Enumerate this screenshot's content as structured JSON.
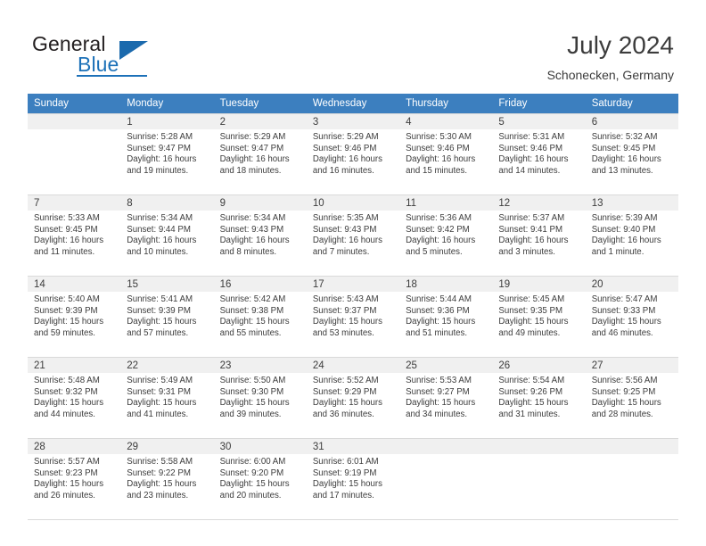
{
  "logo": {
    "word1": "General",
    "word2": "Blue",
    "triangle_color": "#1b6aad",
    "blue_color": "#1d71b8"
  },
  "header": {
    "title": "July 2024",
    "subtitle": "Schonecken, Germany"
  },
  "theme": {
    "header_row_bg": "#3c7fbf",
    "daynum_bg": "#f0f0f0",
    "grid_line": "#d9d9d9",
    "text": "#3c3c3c"
  },
  "calendar": {
    "weekday_headers": [
      "Sunday",
      "Monday",
      "Tuesday",
      "Wednesday",
      "Thursday",
      "Friday",
      "Saturday"
    ],
    "labels": {
      "sunrise": "Sunrise:",
      "sunset": "Sunset:",
      "daylight": "Daylight:"
    },
    "weeks": [
      [
        {
          "day": "",
          "sunrise": "",
          "sunset": "",
          "daylight": "",
          "empty": true
        },
        {
          "day": "1",
          "sunrise": "Sunrise: 5:28 AM",
          "sunset": "Sunset: 9:47 PM",
          "daylight_l1": "Daylight: 16 hours",
          "daylight_l2": "and 19 minutes."
        },
        {
          "day": "2",
          "sunrise": "Sunrise: 5:29 AM",
          "sunset": "Sunset: 9:47 PM",
          "daylight_l1": "Daylight: 16 hours",
          "daylight_l2": "and 18 minutes."
        },
        {
          "day": "3",
          "sunrise": "Sunrise: 5:29 AM",
          "sunset": "Sunset: 9:46 PM",
          "daylight_l1": "Daylight: 16 hours",
          "daylight_l2": "and 16 minutes."
        },
        {
          "day": "4",
          "sunrise": "Sunrise: 5:30 AM",
          "sunset": "Sunset: 9:46 PM",
          "daylight_l1": "Daylight: 16 hours",
          "daylight_l2": "and 15 minutes."
        },
        {
          "day": "5",
          "sunrise": "Sunrise: 5:31 AM",
          "sunset": "Sunset: 9:46 PM",
          "daylight_l1": "Daylight: 16 hours",
          "daylight_l2": "and 14 minutes."
        },
        {
          "day": "6",
          "sunrise": "Sunrise: 5:32 AM",
          "sunset": "Sunset: 9:45 PM",
          "daylight_l1": "Daylight: 16 hours",
          "daylight_l2": "and 13 minutes."
        }
      ],
      [
        {
          "day": "7",
          "sunrise": "Sunrise: 5:33 AM",
          "sunset": "Sunset: 9:45 PM",
          "daylight_l1": "Daylight: 16 hours",
          "daylight_l2": "and 11 minutes."
        },
        {
          "day": "8",
          "sunrise": "Sunrise: 5:34 AM",
          "sunset": "Sunset: 9:44 PM",
          "daylight_l1": "Daylight: 16 hours",
          "daylight_l2": "and 10 minutes."
        },
        {
          "day": "9",
          "sunrise": "Sunrise: 5:34 AM",
          "sunset": "Sunset: 9:43 PM",
          "daylight_l1": "Daylight: 16 hours",
          "daylight_l2": "and 8 minutes."
        },
        {
          "day": "10",
          "sunrise": "Sunrise: 5:35 AM",
          "sunset": "Sunset: 9:43 PM",
          "daylight_l1": "Daylight: 16 hours",
          "daylight_l2": "and 7 minutes."
        },
        {
          "day": "11",
          "sunrise": "Sunrise: 5:36 AM",
          "sunset": "Sunset: 9:42 PM",
          "daylight_l1": "Daylight: 16 hours",
          "daylight_l2": "and 5 minutes."
        },
        {
          "day": "12",
          "sunrise": "Sunrise: 5:37 AM",
          "sunset": "Sunset: 9:41 PM",
          "daylight_l1": "Daylight: 16 hours",
          "daylight_l2": "and 3 minutes."
        },
        {
          "day": "13",
          "sunrise": "Sunrise: 5:39 AM",
          "sunset": "Sunset: 9:40 PM",
          "daylight_l1": "Daylight: 16 hours",
          "daylight_l2": "and 1 minute."
        }
      ],
      [
        {
          "day": "14",
          "sunrise": "Sunrise: 5:40 AM",
          "sunset": "Sunset: 9:39 PM",
          "daylight_l1": "Daylight: 15 hours",
          "daylight_l2": "and 59 minutes."
        },
        {
          "day": "15",
          "sunrise": "Sunrise: 5:41 AM",
          "sunset": "Sunset: 9:39 PM",
          "daylight_l1": "Daylight: 15 hours",
          "daylight_l2": "and 57 minutes."
        },
        {
          "day": "16",
          "sunrise": "Sunrise: 5:42 AM",
          "sunset": "Sunset: 9:38 PM",
          "daylight_l1": "Daylight: 15 hours",
          "daylight_l2": "and 55 minutes."
        },
        {
          "day": "17",
          "sunrise": "Sunrise: 5:43 AM",
          "sunset": "Sunset: 9:37 PM",
          "daylight_l1": "Daylight: 15 hours",
          "daylight_l2": "and 53 minutes."
        },
        {
          "day": "18",
          "sunrise": "Sunrise: 5:44 AM",
          "sunset": "Sunset: 9:36 PM",
          "daylight_l1": "Daylight: 15 hours",
          "daylight_l2": "and 51 minutes."
        },
        {
          "day": "19",
          "sunrise": "Sunrise: 5:45 AM",
          "sunset": "Sunset: 9:35 PM",
          "daylight_l1": "Daylight: 15 hours",
          "daylight_l2": "and 49 minutes."
        },
        {
          "day": "20",
          "sunrise": "Sunrise: 5:47 AM",
          "sunset": "Sunset: 9:33 PM",
          "daylight_l1": "Daylight: 15 hours",
          "daylight_l2": "and 46 minutes."
        }
      ],
      [
        {
          "day": "21",
          "sunrise": "Sunrise: 5:48 AM",
          "sunset": "Sunset: 9:32 PM",
          "daylight_l1": "Daylight: 15 hours",
          "daylight_l2": "and 44 minutes."
        },
        {
          "day": "22",
          "sunrise": "Sunrise: 5:49 AM",
          "sunset": "Sunset: 9:31 PM",
          "daylight_l1": "Daylight: 15 hours",
          "daylight_l2": "and 41 minutes."
        },
        {
          "day": "23",
          "sunrise": "Sunrise: 5:50 AM",
          "sunset": "Sunset: 9:30 PM",
          "daylight_l1": "Daylight: 15 hours",
          "daylight_l2": "and 39 minutes."
        },
        {
          "day": "24",
          "sunrise": "Sunrise: 5:52 AM",
          "sunset": "Sunset: 9:29 PM",
          "daylight_l1": "Daylight: 15 hours",
          "daylight_l2": "and 36 minutes."
        },
        {
          "day": "25",
          "sunrise": "Sunrise: 5:53 AM",
          "sunset": "Sunset: 9:27 PM",
          "daylight_l1": "Daylight: 15 hours",
          "daylight_l2": "and 34 minutes."
        },
        {
          "day": "26",
          "sunrise": "Sunrise: 5:54 AM",
          "sunset": "Sunset: 9:26 PM",
          "daylight_l1": "Daylight: 15 hours",
          "daylight_l2": "and 31 minutes."
        },
        {
          "day": "27",
          "sunrise": "Sunrise: 5:56 AM",
          "sunset": "Sunset: 9:25 PM",
          "daylight_l1": "Daylight: 15 hours",
          "daylight_l2": "and 28 minutes."
        }
      ],
      [
        {
          "day": "28",
          "sunrise": "Sunrise: 5:57 AM",
          "sunset": "Sunset: 9:23 PM",
          "daylight_l1": "Daylight: 15 hours",
          "daylight_l2": "and 26 minutes."
        },
        {
          "day": "29",
          "sunrise": "Sunrise: 5:58 AM",
          "sunset": "Sunset: 9:22 PM",
          "daylight_l1": "Daylight: 15 hours",
          "daylight_l2": "and 23 minutes."
        },
        {
          "day": "30",
          "sunrise": "Sunrise: 6:00 AM",
          "sunset": "Sunset: 9:20 PM",
          "daylight_l1": "Daylight: 15 hours",
          "daylight_l2": "and 20 minutes."
        },
        {
          "day": "31",
          "sunrise": "Sunrise: 6:01 AM",
          "sunset": "Sunset: 9:19 PM",
          "daylight_l1": "Daylight: 15 hours",
          "daylight_l2": "and 17 minutes."
        },
        {
          "day": "",
          "sunrise": "",
          "sunset": "",
          "daylight_l1": "",
          "daylight_l2": "",
          "empty": true
        },
        {
          "day": "",
          "sunrise": "",
          "sunset": "",
          "daylight_l1": "",
          "daylight_l2": "",
          "empty": true
        },
        {
          "day": "",
          "sunrise": "",
          "sunset": "",
          "daylight_l1": "",
          "daylight_l2": "",
          "empty": true
        }
      ]
    ]
  }
}
